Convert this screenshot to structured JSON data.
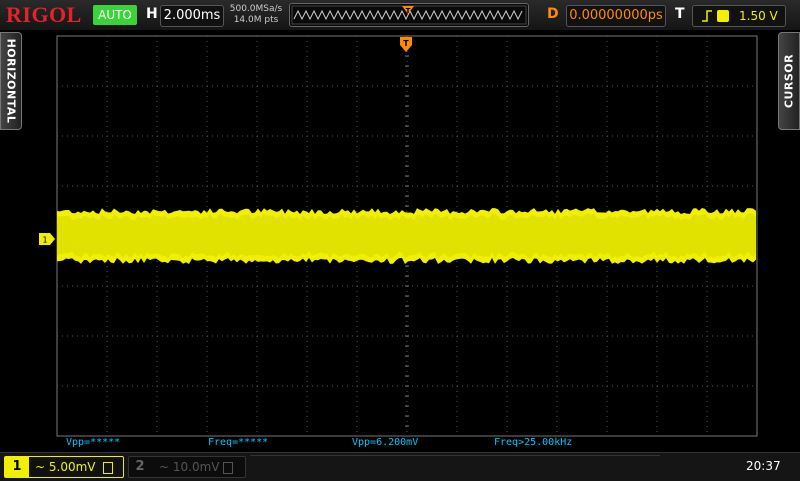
{
  "brand": "RIGOL",
  "run_status": "AUTO",
  "horizontal": {
    "label": "H",
    "timebase": "2.000ms",
    "sample_rate": "500.0MSa/s",
    "memory_depth": "14.0M pts"
  },
  "delay": {
    "label": "D",
    "value": "0.00000000ps"
  },
  "trigger": {
    "label": "T",
    "level": "1.50 V",
    "channel": "1",
    "edge": "rising-edge-icon"
  },
  "side_tabs": {
    "left": "HORIZONTAL",
    "right": "CURSOR"
  },
  "channel_marker": "1",
  "measurements": [
    {
      "text": "Vpp=*****"
    },
    {
      "text": "Freq=*****"
    },
    {
      "text": "Vpp=6.200mV"
    },
    {
      "text": "Freq>25.00kHz"
    }
  ],
  "channels": [
    {
      "number": "1",
      "coupling": "~",
      "scale": "5.00mV",
      "active": true
    },
    {
      "number": "2",
      "coupling": "~",
      "scale": "10.0mV",
      "active": false
    }
  ],
  "clock": "20:37",
  "colors": {
    "ch1": "#f0f000",
    "measure": "#00c8ff",
    "delay": "#ff8c00",
    "status": "#3ad43a",
    "brand": "#e3232b"
  }
}
